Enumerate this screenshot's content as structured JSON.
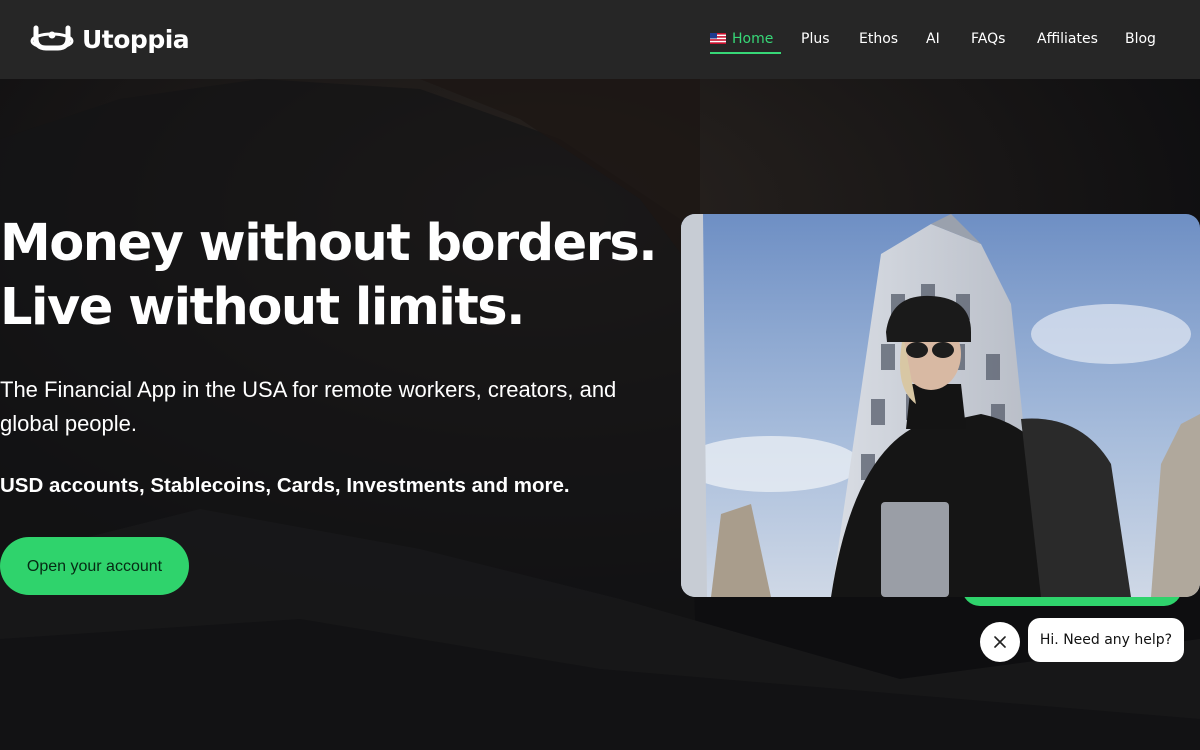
{
  "brand": {
    "name": "Utoppia",
    "accent": "#2fd36c",
    "header_bg": "#262626",
    "page_bg": "#0f0f10"
  },
  "nav": {
    "home_flag": "us-flag-icon",
    "items": [
      {
        "label": "Home",
        "active": true
      },
      {
        "label": "Plus",
        "active": false
      },
      {
        "label": "Ethos",
        "active": false
      },
      {
        "label": "AI",
        "active": false
      },
      {
        "label": "FAQs",
        "active": false
      },
      {
        "label": "Affiliates",
        "active": false
      },
      {
        "label": "Blog",
        "active": false
      }
    ]
  },
  "hero": {
    "headline_line1": "Money without borders.",
    "headline_line2": "Live without limits.",
    "subheadline": "The Financial App in the USA for remote workers, creators, and global people.",
    "features": "USD accounts, Stablecoins, Cards, Investments and more.",
    "cta_label": "Open your account"
  },
  "chat": {
    "message": "Hi. Need any help?",
    "close_icon": "close-icon"
  }
}
